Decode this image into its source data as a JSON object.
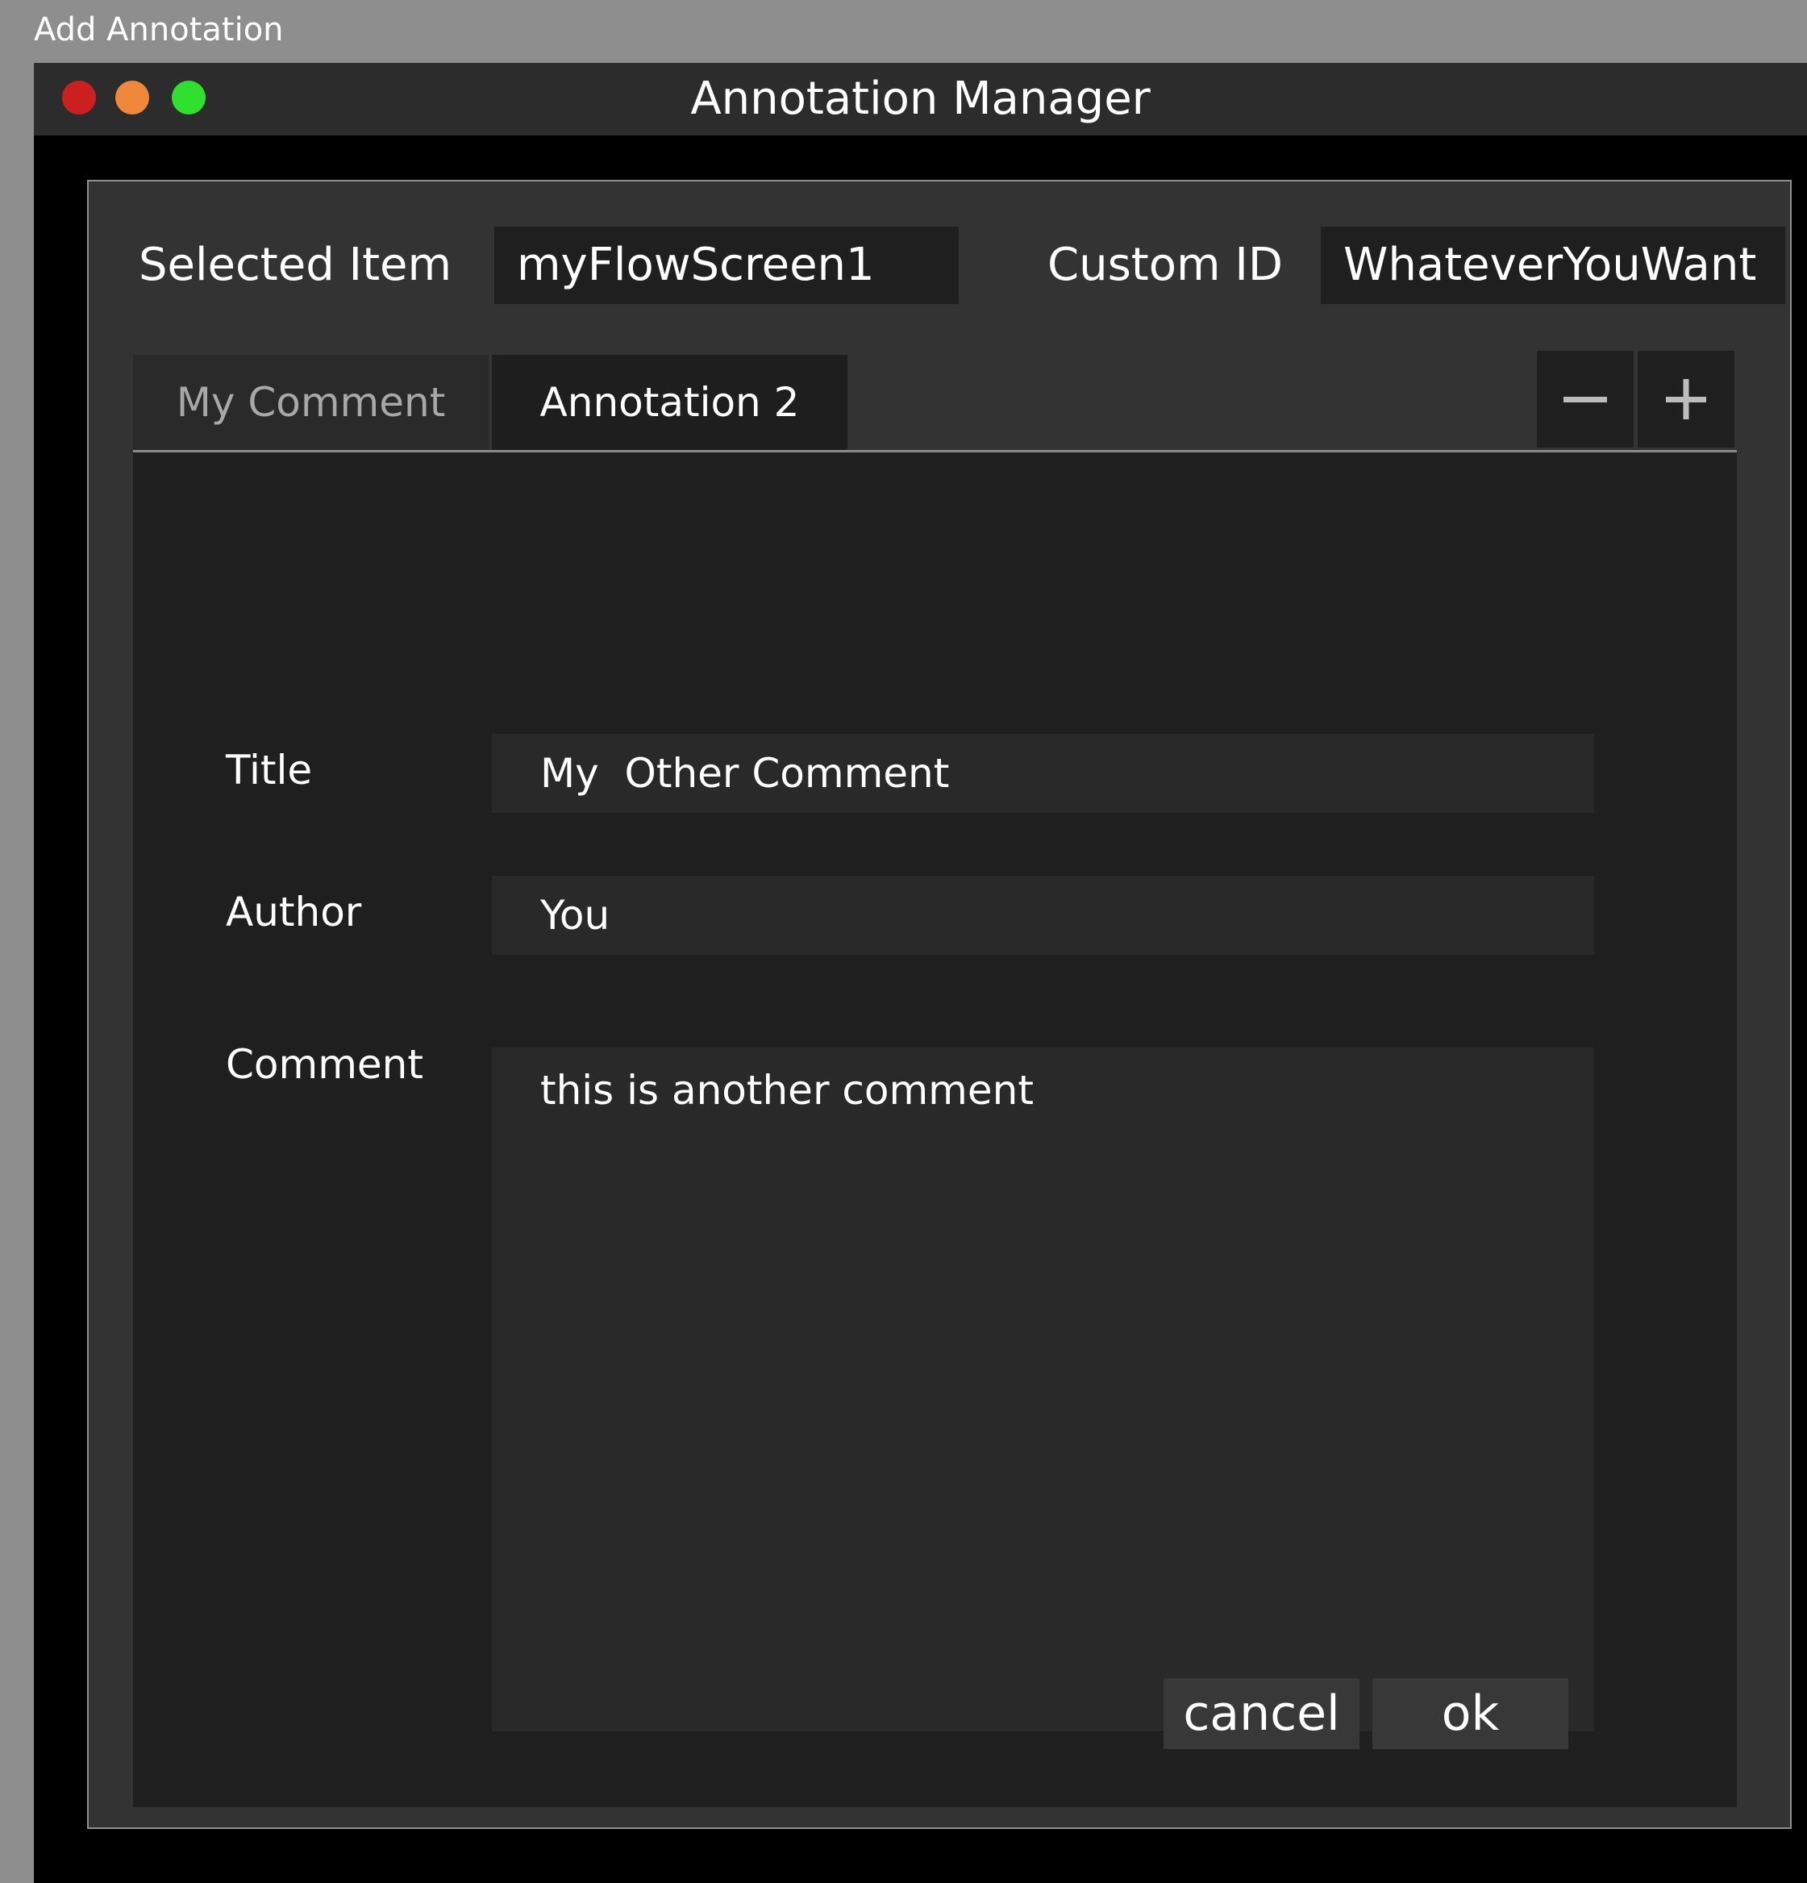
{
  "caption": "Add Annotation",
  "window": {
    "title": "Annotation Manager",
    "controls": [
      "close",
      "minimize",
      "zoom"
    ],
    "control_colors": {
      "close": "#cc1f1f",
      "minimize": "#f0883c",
      "zoom": "#2fe02f"
    }
  },
  "header": {
    "selected_item_label": "Selected Item",
    "selected_item_value": "myFlowScreen1",
    "custom_id_label": "Custom ID",
    "custom_id_value": "WhateverYouWant"
  },
  "tabs": [
    {
      "label": "My Comment",
      "active": false
    },
    {
      "label": "Annotation 2",
      "active": true
    }
  ],
  "tab_actions": {
    "remove_icon": "minus-icon",
    "add_icon": "plus-icon"
  },
  "form": {
    "title_label": "Title",
    "title_value": "My  Other Comment",
    "author_label": "Author",
    "author_value": "You",
    "comment_label": "Comment",
    "comment_value": "this is another comment"
  },
  "buttons": {
    "cancel": "cancel",
    "ok": "ok"
  }
}
